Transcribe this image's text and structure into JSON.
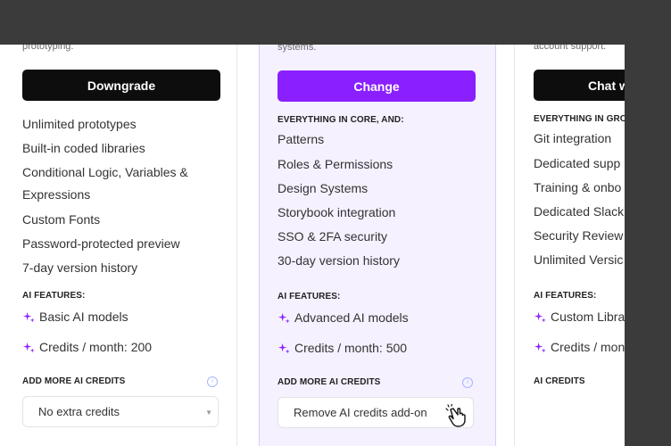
{
  "plans": [
    {
      "description": "prototyping.",
      "button_label": "Downgrade",
      "features": [
        "Unlimited prototypes",
        "Built-in coded libraries",
        "Conditional Logic, Variables &",
        "Expressions",
        "Custom Fonts",
        "Password-protected preview",
        "7-day version history"
      ],
      "ai_label": "AI FEATURES:",
      "ai_features": [
        "Basic AI models",
        "Credits / month: 200"
      ],
      "credits_label": "ADD MORE AI CREDITS",
      "credits_select": "No extra credits"
    },
    {
      "description": "systems.",
      "button_label": "Change",
      "features_heading": "EVERYTHING IN CORE, AND:",
      "features": [
        "Patterns",
        "Roles & Permissions",
        "Design Systems",
        "Storybook integration",
        "SSO & 2FA security",
        "30-day version history"
      ],
      "ai_label": "AI FEATURES:",
      "ai_features": [
        "Advanced AI models",
        "Credits / month: 500"
      ],
      "credits_label": "ADD MORE AI CREDITS",
      "credits_select": "Remove AI credits add-on"
    },
    {
      "description": "account support.",
      "button_label": "Chat w",
      "features_heading": "EVERYTHING IN GROW",
      "features": [
        "Git integration",
        "Dedicated supp",
        "Training & onbo",
        "Dedicated Slack",
        "Security Review",
        "Unlimited Versic"
      ],
      "ai_label": "AI FEATURES:",
      "ai_features": [
        "Custom Libra",
        "Credits / mon"
      ],
      "credits_label": "AI CREDITS"
    }
  ],
  "colors": {
    "accent": "#8a1fff",
    "dark_button": "#0d0d0d",
    "sparkle": "#8a1fff"
  },
  "icons": {
    "sparkle": "sparkle-icon",
    "info": "info-icon",
    "caret": "chevron-down-icon",
    "cursor": "hand-pointer-icon"
  }
}
